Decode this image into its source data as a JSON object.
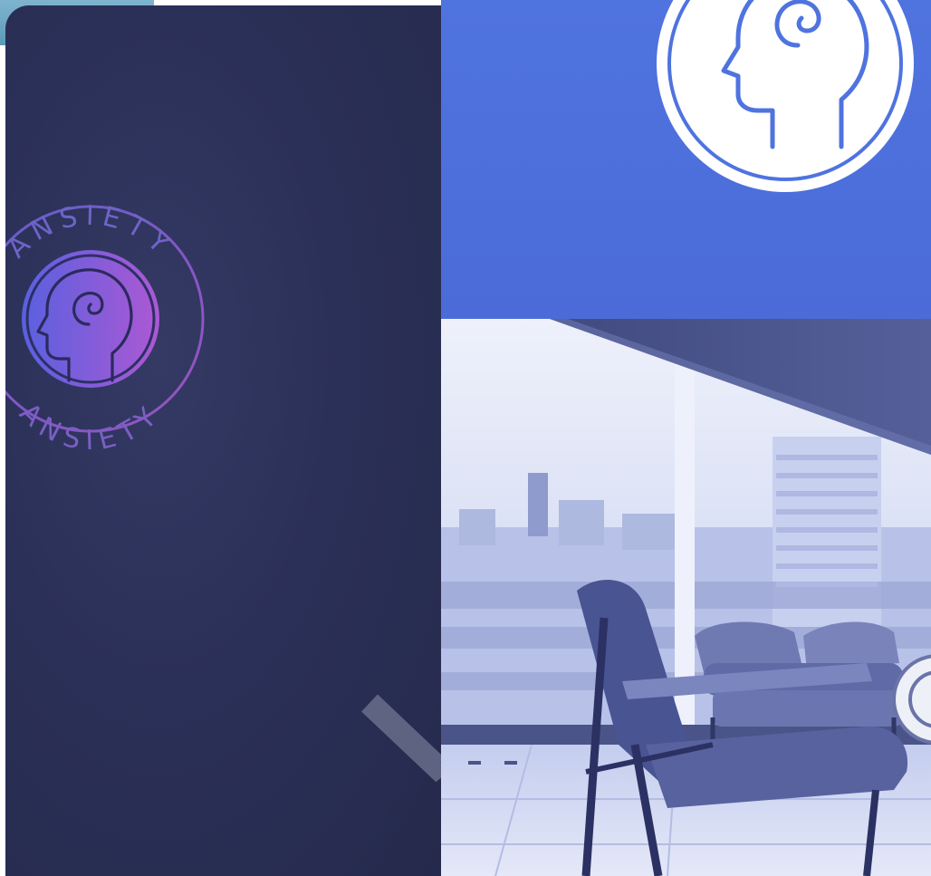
{
  "badge": {
    "top_text": "ANSIETY",
    "bottom_text": "ANSIETY",
    "icon": "spiral-head-icon"
  },
  "hero_icon": "head-profile-icon",
  "decor_icon": "chevron-down-icon",
  "colors": {
    "left_panel": "#2b3058",
    "blue_panel": "#4f73df",
    "badge_gradient_start": "#5b63e6",
    "badge_gradient_end": "#b35ad9",
    "photo_tint": "#b7c3ec"
  }
}
